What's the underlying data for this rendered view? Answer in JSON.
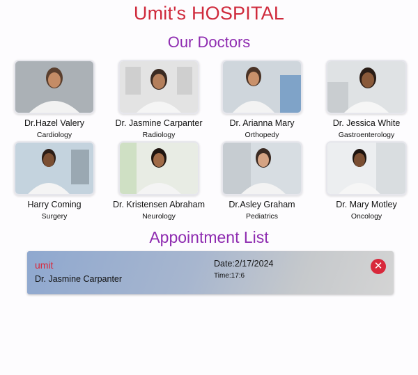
{
  "header": {
    "hospital_name": "Umit's HOSPITAL",
    "doctors_heading": "Our Doctors"
  },
  "doctors": [
    {
      "name": "Dr.Hazel Valery",
      "specialty": "Cardiology"
    },
    {
      "name": "Dr. Jasmine Carpanter",
      "specialty": "Radiology"
    },
    {
      "name": "Dr. Arianna Mary",
      "specialty": "Orthopedy"
    },
    {
      "name": "Dr. Jessica White",
      "specialty": "Gastroenterology"
    },
    {
      "name": "Harry Coming",
      "specialty": "Surgery"
    },
    {
      "name": "Dr. Kristensen Abraham",
      "specialty": "Neurology"
    },
    {
      "name": "Dr.Asley Graham",
      "specialty": "Pediatrics"
    },
    {
      "name": "Dr. Mary Motley",
      "specialty": "Oncology"
    }
  ],
  "appointments": {
    "heading": "Appointment List",
    "items": [
      {
        "patient": "umit",
        "doctor": "Dr. Jasmine Carpanter",
        "date": "Date:2/17/2024",
        "time": "Time:17:6",
        "delete_icon": "close-circle-icon"
      }
    ]
  },
  "colors": {
    "title": "#cf2a3c",
    "heading": "#8e2bb0",
    "danger": "#d8283b"
  }
}
